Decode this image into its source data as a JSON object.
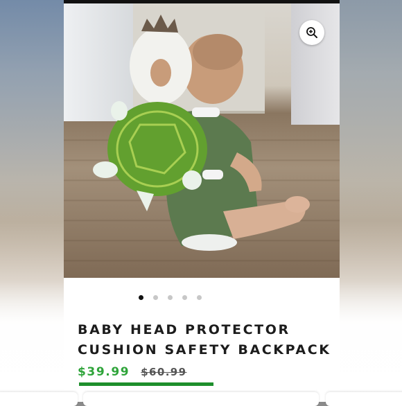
{
  "product": {
    "title": "BABY HEAD PROTECTOR CUSHION SAFETY BACKPACK",
    "sale_price": "$39.99",
    "original_price": "$60.99"
  },
  "gallery": {
    "image_count": 5,
    "active_index": 0
  },
  "icons": {
    "zoom": "zoom-in-icon"
  },
  "progress": {
    "fraction": 0.54
  },
  "colors": {
    "sale_price": "#2fa43a",
    "progress": "#1e8f2c",
    "active_dot": "#111111",
    "inactive_dot": "#c7c7c7"
  }
}
